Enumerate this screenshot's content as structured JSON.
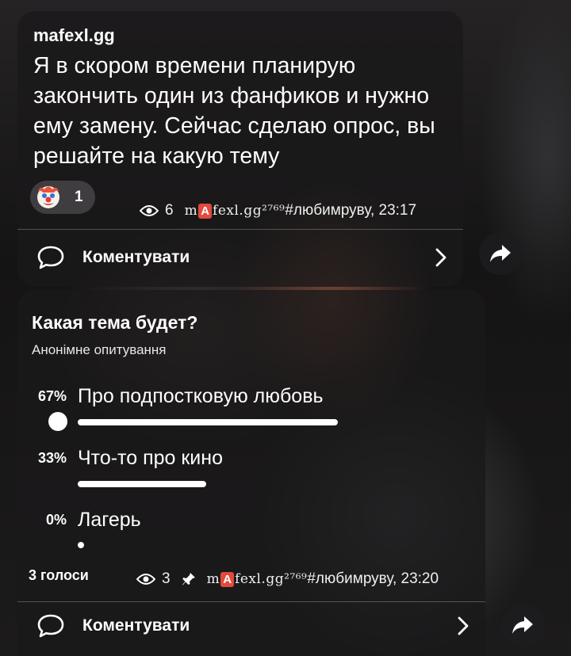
{
  "message": {
    "author": "mafexl.gg",
    "text": "Я в скором времени планирую закончить один из фанфиков и нужно ему замену. Сейчас сделаю опрос, вы решайте на какую тему",
    "reaction_icon": "clown-face-icon",
    "reaction_count": "1",
    "views": "6",
    "signature_pre": "m",
    "signature_a": "A",
    "signature_post": "fexl.gg²⁷⁶⁹",
    "hashtag_time": "#любимруву, 23:17",
    "comment_label": "Коментувати"
  },
  "poll": {
    "question": "Какая тема будет?",
    "type": "Анонімне опитування",
    "options": [
      {
        "percent": "67%",
        "text": "Про подпостковую любовь",
        "share": 0.67,
        "chosen": true
      },
      {
        "percent": "33%",
        "text": "Что-то про кино",
        "share": 0.33,
        "chosen": false
      },
      {
        "percent": "0%",
        "text": "Лагерь",
        "share": 0.0,
        "chosen": false
      }
    ],
    "votes": "3 голоси",
    "views": "3",
    "signature_pre": "m",
    "signature_a": "A",
    "signature_post": "fexl.gg²⁷⁶⁹",
    "hashtag_time": "#любимруву, 23:20",
    "comment_label": "Коментувати"
  },
  "colors": {
    "accent": "#ffffff",
    "badge": "#e24a3b"
  }
}
